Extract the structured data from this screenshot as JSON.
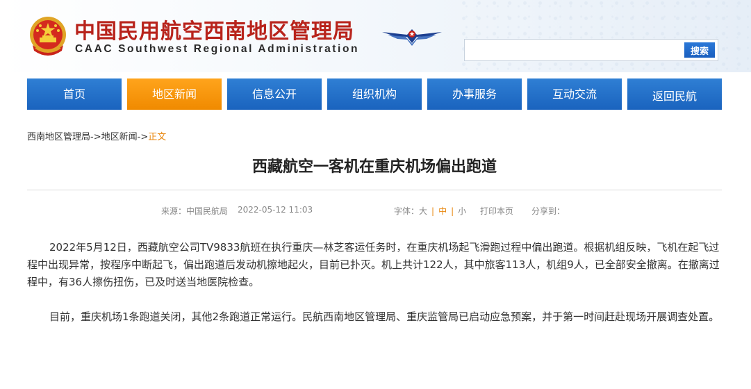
{
  "header": {
    "title": "中国民用航空西南地区管理局",
    "subtitle": "CAAC Southwest Regional Administration",
    "emblem_icon": "national-emblem-icon",
    "logo_icon": "caac-wings-logo-icon",
    "colors": {
      "title": "#b8231b",
      "nav": "#2272c9",
      "nav_active": "#f7961a",
      "accent": "#e8860c"
    }
  },
  "search": {
    "placeholder": "",
    "button_label": "搜索"
  },
  "nav": {
    "items": [
      {
        "label": "首页"
      },
      {
        "label": "地区新闻",
        "active": true
      },
      {
        "label": "信息公开"
      },
      {
        "label": "组织机构"
      },
      {
        "label": "办事服务"
      },
      {
        "label": "互动交流"
      },
      {
        "label": "返回民航"
      }
    ]
  },
  "breadcrumb": {
    "items": [
      "西南地区管理局",
      "地区新闻",
      "正文"
    ],
    "separator": "->"
  },
  "article": {
    "title": "西藏航空一客机在重庆机场偏出跑道",
    "source": "来源：中国民航局",
    "date": "2022-05-12 11:03",
    "font_size_label": "字体：",
    "font_sizes": [
      "大",
      "中",
      "小"
    ],
    "print_label": "打印本页",
    "share_label": "分享到：",
    "paragraphs": [
      "2022年5月12日，西藏航空公司TV9833航班在执行重庆—林芝客运任务时，在重庆机场起飞滑跑过程中偏出跑道。根据机组反映，飞机在起飞过程中出现异常，按程序中断起飞，偏出跑道后发动机擦地起火，目前已扑灭。机上共计122人，其中旅客113人，机组9人，已全部安全撤离。在撤离过程中，有36人擦伤扭伤，已及时送当地医院检查。",
      "目前，重庆机场1条跑道关闭，其他2条跑道正常运行。民航西南地区管理局、重庆监管局已启动应急预案，并于第一时间赶赴现场开展调查处置。"
    ]
  }
}
